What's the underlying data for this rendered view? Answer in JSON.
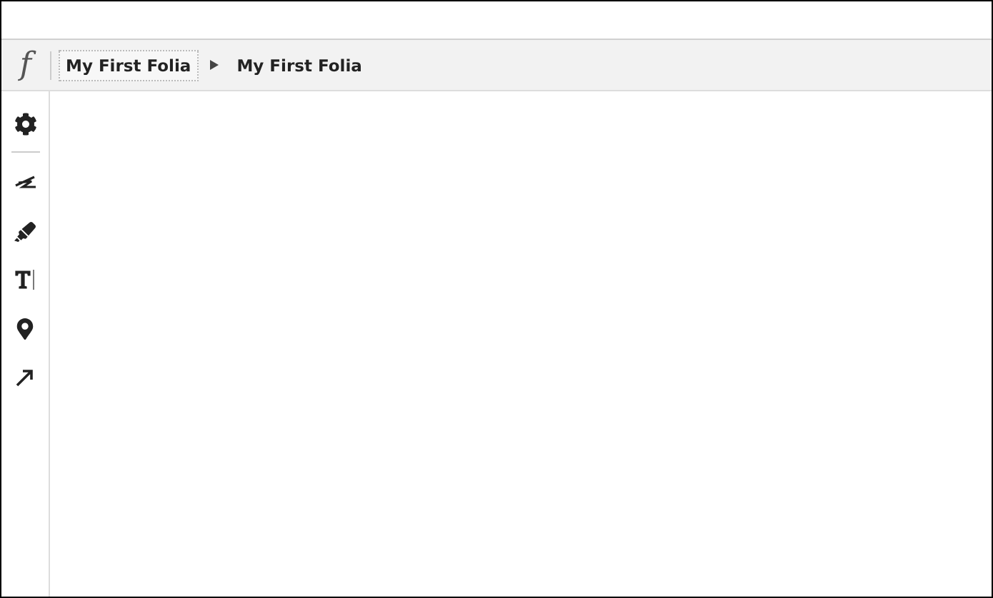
{
  "header": {
    "logo": "f",
    "breadcrumbs": [
      {
        "label": "My First Folia",
        "selected": true
      },
      {
        "label": "My First Folia",
        "selected": false
      }
    ]
  },
  "toolbar": {
    "tools": [
      {
        "kind": "settings"
      },
      {
        "kind": "divider"
      },
      {
        "kind": "pen"
      },
      {
        "kind": "highlighter"
      },
      {
        "kind": "text"
      },
      {
        "kind": "pin"
      },
      {
        "kind": "arrow"
      }
    ]
  }
}
